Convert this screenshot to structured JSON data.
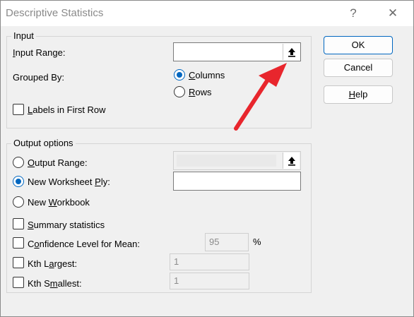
{
  "window": {
    "title": "Descriptive Statistics",
    "help_glyph": "?",
    "close_glyph": "✕"
  },
  "input": {
    "group_title": "Input",
    "input_range_label": "Input Range:",
    "input_range_value": "",
    "grouped_by_label": "Grouped By:",
    "columns_label": "Columns",
    "rows_label": "Rows",
    "grouped_by_selected": "Columns",
    "labels_first_row_label": "Labels in First Row",
    "labels_first_row_checked": false
  },
  "output": {
    "group_title": "Output options",
    "output_range_label": "Output Range:",
    "new_worksheet_label": "New Worksheet Ply:",
    "new_workbook_label": "New Workbook",
    "selected": "New Worksheet Ply",
    "summary_label": "Summary statistics",
    "confidence_label": "Confidence Level for Mean:",
    "confidence_value": "95",
    "percent_sign": "%",
    "kth_largest_label": "Kth Largest:",
    "kth_largest_value": "1",
    "kth_smallest_label": "Kth Smallest:",
    "kth_smallest_value": "1"
  },
  "buttons": {
    "ok": "OK",
    "cancel": "Cancel",
    "help": "Help"
  },
  "icons": {
    "collapse": "collapse-dialog-icon",
    "annotation": "red-arrow-icon"
  },
  "colors": {
    "accent": "#0067c0",
    "annotation": "#e8262d"
  }
}
